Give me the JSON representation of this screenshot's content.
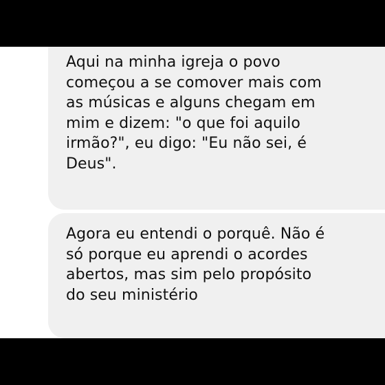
{
  "conversation": {
    "messages": [
      {
        "text": "Aqui na minha igreja o povo\ncomeçou a se comover mais com\nas músicas e alguns chegam em\nmim e dizem: \"o que foi aquilo\nirmão?\", eu digo: \"Eu não sei, é\nDeus\"."
      },
      {
        "text": "Agora eu entendi o porquê. Não é\nsó porque eu aprendi o acordes\nabertos, mas sim pelo propósito\ndo seu ministério"
      }
    ],
    "sender": {
      "avatar_icon": "user-avatar-photo"
    },
    "colors": {
      "bubble_background": "#f0f0f0",
      "text": "#111111",
      "letterbox": "#000000"
    }
  }
}
